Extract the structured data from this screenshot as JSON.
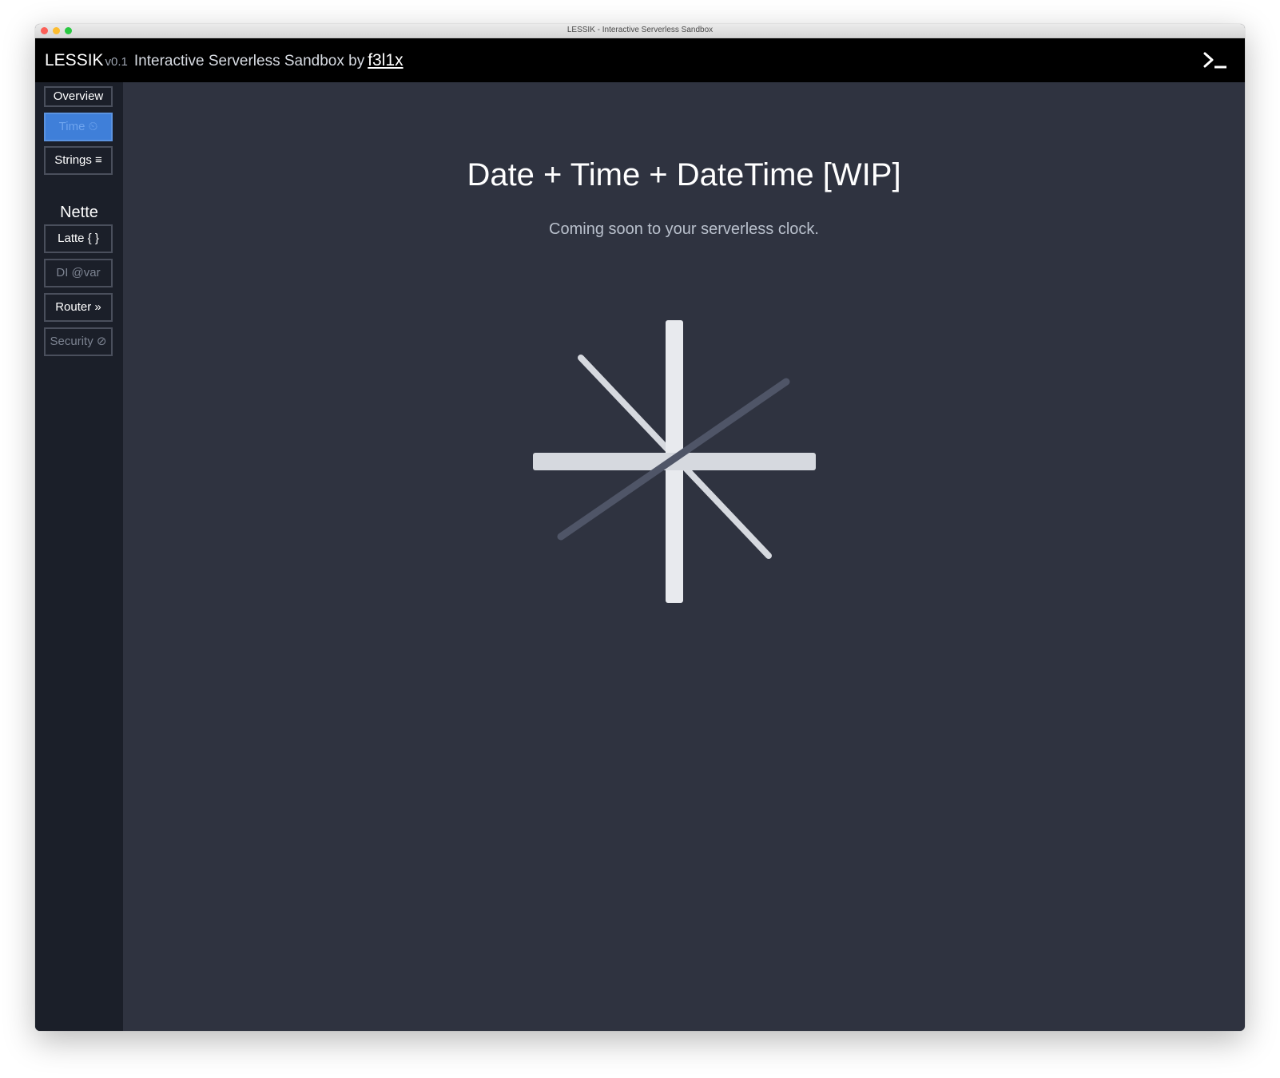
{
  "window": {
    "title": "LESSIK - Interactive Serverless Sandbox"
  },
  "header": {
    "brand": "LESSIK",
    "version": "v0.1",
    "tagline": "Interactive Serverless Sandbox by",
    "author": "f3l1x",
    "terminal_icon": "terminal-prompt-icon"
  },
  "sidebar": {
    "items": [
      {
        "label": "Overview",
        "state": "default"
      },
      {
        "label": "Time ⏲",
        "state": "active"
      },
      {
        "label": "Strings ≡",
        "state": "default"
      }
    ],
    "nette_section": {
      "title": "Nette",
      "items": [
        {
          "label": "Latte { }",
          "state": "default"
        },
        {
          "label": "DI @var",
          "state": "disabled"
        },
        {
          "label": "Router »",
          "state": "default"
        },
        {
          "label": "Security ⊘",
          "state": "disabled"
        }
      ]
    }
  },
  "main": {
    "heading": "Date + Time + DateTime [WIP]",
    "subheading": "Coming soon to your serverless clock.",
    "illustration": "clock-hands-icon"
  },
  "colors": {
    "content_bg": "#2f3340",
    "sidebar_bg": "#1b1f29",
    "header_bg": "#000000",
    "active_accent": "#3f7fd9",
    "hand_light": "#d6d9df",
    "hand_dark": "#4f5567"
  }
}
